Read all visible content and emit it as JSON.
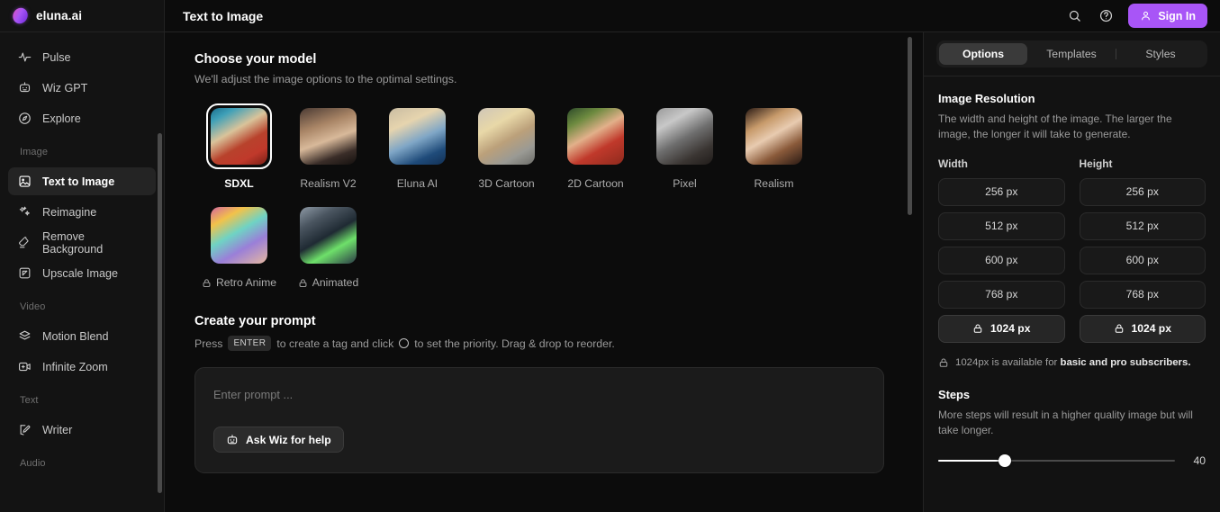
{
  "brand": {
    "name": "eluna.ai",
    "logo_icon": "eluna-logo-icon",
    "accent": "#a855f7"
  },
  "sidebar": {
    "groups": [
      {
        "label": "",
        "items": [
          {
            "label": "Pulse",
            "icon": "pulse-icon",
            "active": false
          },
          {
            "label": "Wiz GPT",
            "icon": "robot-icon",
            "active": false
          },
          {
            "label": "Explore",
            "icon": "compass-icon",
            "active": false
          }
        ]
      },
      {
        "label": "Image",
        "items": [
          {
            "label": "Text to Image",
            "icon": "image-icon",
            "active": true
          },
          {
            "label": "Reimagine",
            "icon": "sparkles-icon",
            "active": false
          },
          {
            "label": "Remove Background",
            "icon": "eraser-icon",
            "active": false
          },
          {
            "label": "Upscale Image",
            "icon": "upscale-icon",
            "active": false
          }
        ]
      },
      {
        "label": "Video",
        "items": [
          {
            "label": "Motion Blend",
            "icon": "layers-icon",
            "active": false
          },
          {
            "label": "Infinite Zoom",
            "icon": "video-icon",
            "active": false
          }
        ]
      },
      {
        "label": "Text",
        "items": [
          {
            "label": "Writer",
            "icon": "pencil-note-icon",
            "active": false
          }
        ]
      },
      {
        "label": "Audio",
        "items": []
      }
    ]
  },
  "topbar": {
    "title": "Text to Image",
    "search_icon": "search-icon",
    "help_icon": "help-circle-icon",
    "signin_label": "Sign In",
    "signin_icon": "user-icon"
  },
  "main": {
    "model_section": {
      "title": "Choose your model",
      "subtitle": "We'll adjust the image options to the optimal settings.",
      "models": [
        {
          "label": "SDXL",
          "selected": true,
          "locked": false
        },
        {
          "label": "Realism V2",
          "selected": false,
          "locked": false
        },
        {
          "label": "Eluna AI",
          "selected": false,
          "locked": false
        },
        {
          "label": "3D Cartoon",
          "selected": false,
          "locked": false
        },
        {
          "label": "2D Cartoon",
          "selected": false,
          "locked": false
        },
        {
          "label": "Pixel",
          "selected": false,
          "locked": false
        },
        {
          "label": "Realism",
          "selected": false,
          "locked": false
        },
        {
          "label": "Retro Anime",
          "selected": false,
          "locked": true
        },
        {
          "label": "Animated",
          "selected": false,
          "locked": true
        }
      ]
    },
    "prompt_section": {
      "title": "Create your prompt",
      "hint_before": "Press",
      "hint_key": "ENTER",
      "hint_middle": "to create a tag and click",
      "hint_after": "to set the priority. Drag & drop to reorder.",
      "placeholder": "Enter prompt ...",
      "ask_wiz_label": "Ask Wiz for help",
      "ask_wiz_icon": "robot-icon"
    }
  },
  "rightpanel": {
    "tabs": [
      {
        "label": "Options",
        "active": true
      },
      {
        "label": "Templates",
        "active": false
      },
      {
        "label": "Styles",
        "active": false
      }
    ],
    "resolution": {
      "title": "Image Resolution",
      "description": "The width and height of the image. The larger the image, the longer it will take to generate.",
      "width_label": "Width",
      "height_label": "Height",
      "width_options": [
        {
          "label": "256 px",
          "locked": false
        },
        {
          "label": "512 px",
          "locked": false
        },
        {
          "label": "600 px",
          "locked": false
        },
        {
          "label": "768 px",
          "locked": false
        },
        {
          "label": "1024 px",
          "locked": true
        }
      ],
      "height_options": [
        {
          "label": "256 px",
          "locked": false
        },
        {
          "label": "512 px",
          "locked": false
        },
        {
          "label": "600 px",
          "locked": false
        },
        {
          "label": "768 px",
          "locked": false
        },
        {
          "label": "1024 px",
          "locked": true
        }
      ],
      "note_prefix": "1024px is available for ",
      "note_bold": "basic and pro subscribers.",
      "lock_icon": "lock-icon"
    },
    "steps": {
      "title": "Steps",
      "description": "More steps will result in a higher quality image but will take longer.",
      "value": "40",
      "percent": 28
    }
  }
}
